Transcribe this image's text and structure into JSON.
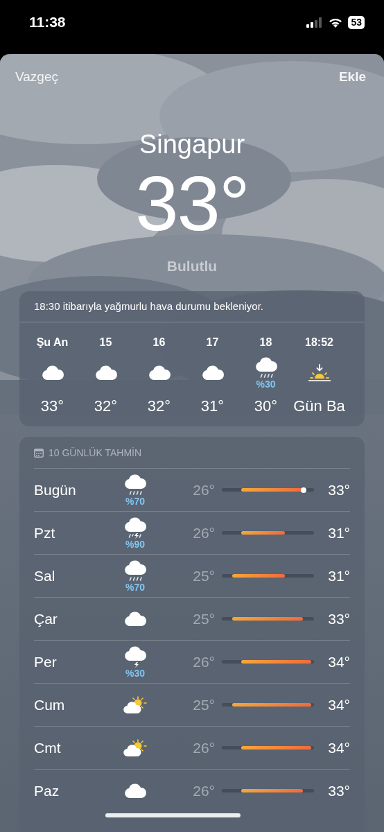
{
  "status_bar": {
    "time": "11:38",
    "battery": "53"
  },
  "header": {
    "cancel": "Vazgeç",
    "add": "Ekle"
  },
  "current": {
    "city": "Singapur",
    "temperature": "33°",
    "condition": "Bulutlu"
  },
  "hourly": {
    "summary": "18:30 itibarıyla yağmurlu hava durumu bekleniyor.",
    "items": [
      {
        "label": "Şu An",
        "kind": "cloud",
        "temp": "33°"
      },
      {
        "label": "15",
        "kind": "cloud",
        "temp": "32°"
      },
      {
        "label": "16",
        "kind": "cloud",
        "temp": "32°"
      },
      {
        "label": "17",
        "kind": "cloud",
        "temp": "31°"
      },
      {
        "label": "18",
        "kind": "rain",
        "precip": "%30",
        "temp": "30°"
      },
      {
        "label": "18:52",
        "kind": "sunset",
        "temp": "Gün Ba"
      }
    ]
  },
  "daily": {
    "title": "10 GÜNLÜK TAHMİN",
    "days": [
      {
        "day": "Bugün",
        "kind": "rain",
        "precip": "%70",
        "low": "26°",
        "high": "33°",
        "current_marker": true
      },
      {
        "day": "Pzt",
        "kind": "thunder-rain",
        "precip": "%90",
        "low": "26°",
        "high": "31°",
        "current_marker": false
      },
      {
        "day": "Sal",
        "kind": "rain",
        "precip": "%70",
        "low": "25°",
        "high": "31°",
        "current_marker": false
      },
      {
        "day": "Çar",
        "kind": "cloud",
        "low": "25°",
        "high": "33°",
        "current_marker": false
      },
      {
        "day": "Per",
        "kind": "thunder",
        "precip": "%30",
        "low": "26°",
        "high": "34°",
        "current_marker": false
      },
      {
        "day": "Cum",
        "kind": "partly-sunny",
        "low": "25°",
        "high": "34°",
        "current_marker": false
      },
      {
        "day": "Cmt",
        "kind": "partly-sunny",
        "low": "26°",
        "high": "34°",
        "current_marker": false
      },
      {
        "day": "Paz",
        "kind": "cloud",
        "low": "26°",
        "high": "33°",
        "current_marker": false
      }
    ]
  }
}
